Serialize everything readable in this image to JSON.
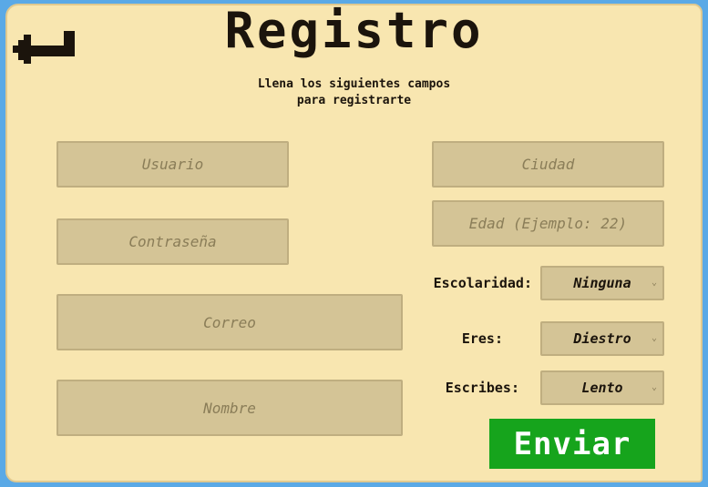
{
  "header": {
    "title": "Registro",
    "subtitle_line1": "Llena los siguientes campos",
    "subtitle_line2": "para registrarte"
  },
  "back": {
    "icon": "arrow-back-icon"
  },
  "fields": {
    "usuario": "Usuario",
    "ciudad": "Ciudad",
    "contrasena": "Contraseña",
    "edad": "Edad (Ejemplo: 22)",
    "correo": "Correo",
    "nombre": "Nombre"
  },
  "selects": {
    "escolaridad": {
      "label": "Escolaridad:",
      "value": "Ninguna"
    },
    "eres": {
      "label": "Eres:",
      "value": "Diestro"
    },
    "escribes": {
      "label": "Escribes:",
      "value": "Lento"
    }
  },
  "submit": {
    "label": "Enviar"
  },
  "colors": {
    "panel": "#f8e6b0",
    "field": "#d4c496",
    "button": "#16a41c",
    "background": "#5aa9e6"
  }
}
